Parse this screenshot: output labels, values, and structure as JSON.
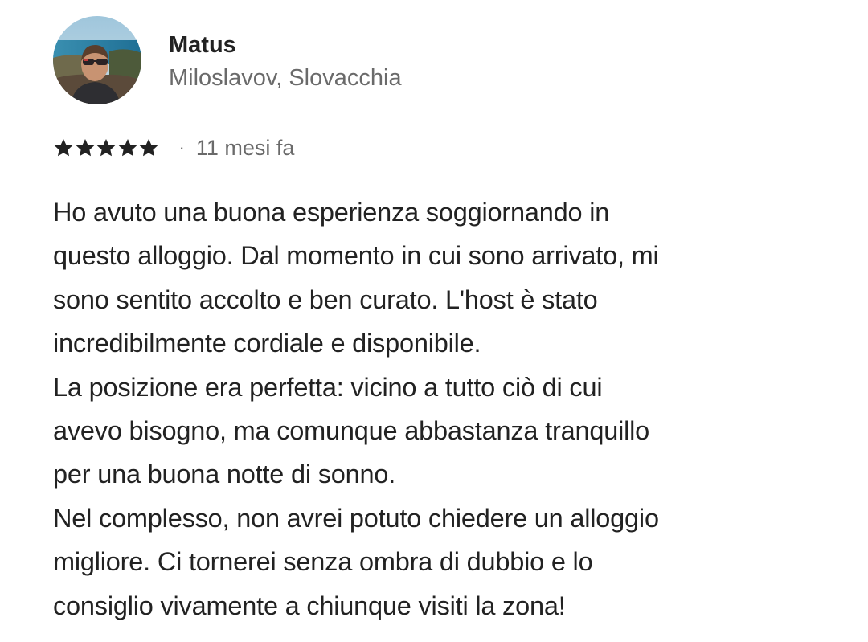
{
  "reviewer": {
    "name": "Matus",
    "location": "Miloslavov, Slovacchia",
    "avatar_icon": "user-photo-avatar"
  },
  "review": {
    "rating": 5,
    "rating_max": 5,
    "star_icon": "star-icon",
    "star_color": "#222222",
    "separator": "·",
    "date": "11 mesi fa",
    "paragraphs": [
      "Ho avuto una buona esperienza soggiornando in\nquesto alloggio. Dal momento in cui sono arrivato, mi\nsono sentito accolto e ben curato. L'host è stato\nincredibilmente cordiale e disponibile.",
      "La posizione era perfetta: vicino a tutto ciò di cui\navevo bisogno, ma comunque abbastanza tranquillo\nper una buona notte di sonno.",
      "Nel complesso, non avrei potuto chiedere un alloggio\nmigliore. Ci tornerei senza ombra di dubbio e lo\nconsiglio vivamente a chiunque visiti la zona!"
    ]
  },
  "colors": {
    "text_primary": "#222222",
    "text_secondary": "#6a6a6a",
    "background": "#ffffff"
  }
}
